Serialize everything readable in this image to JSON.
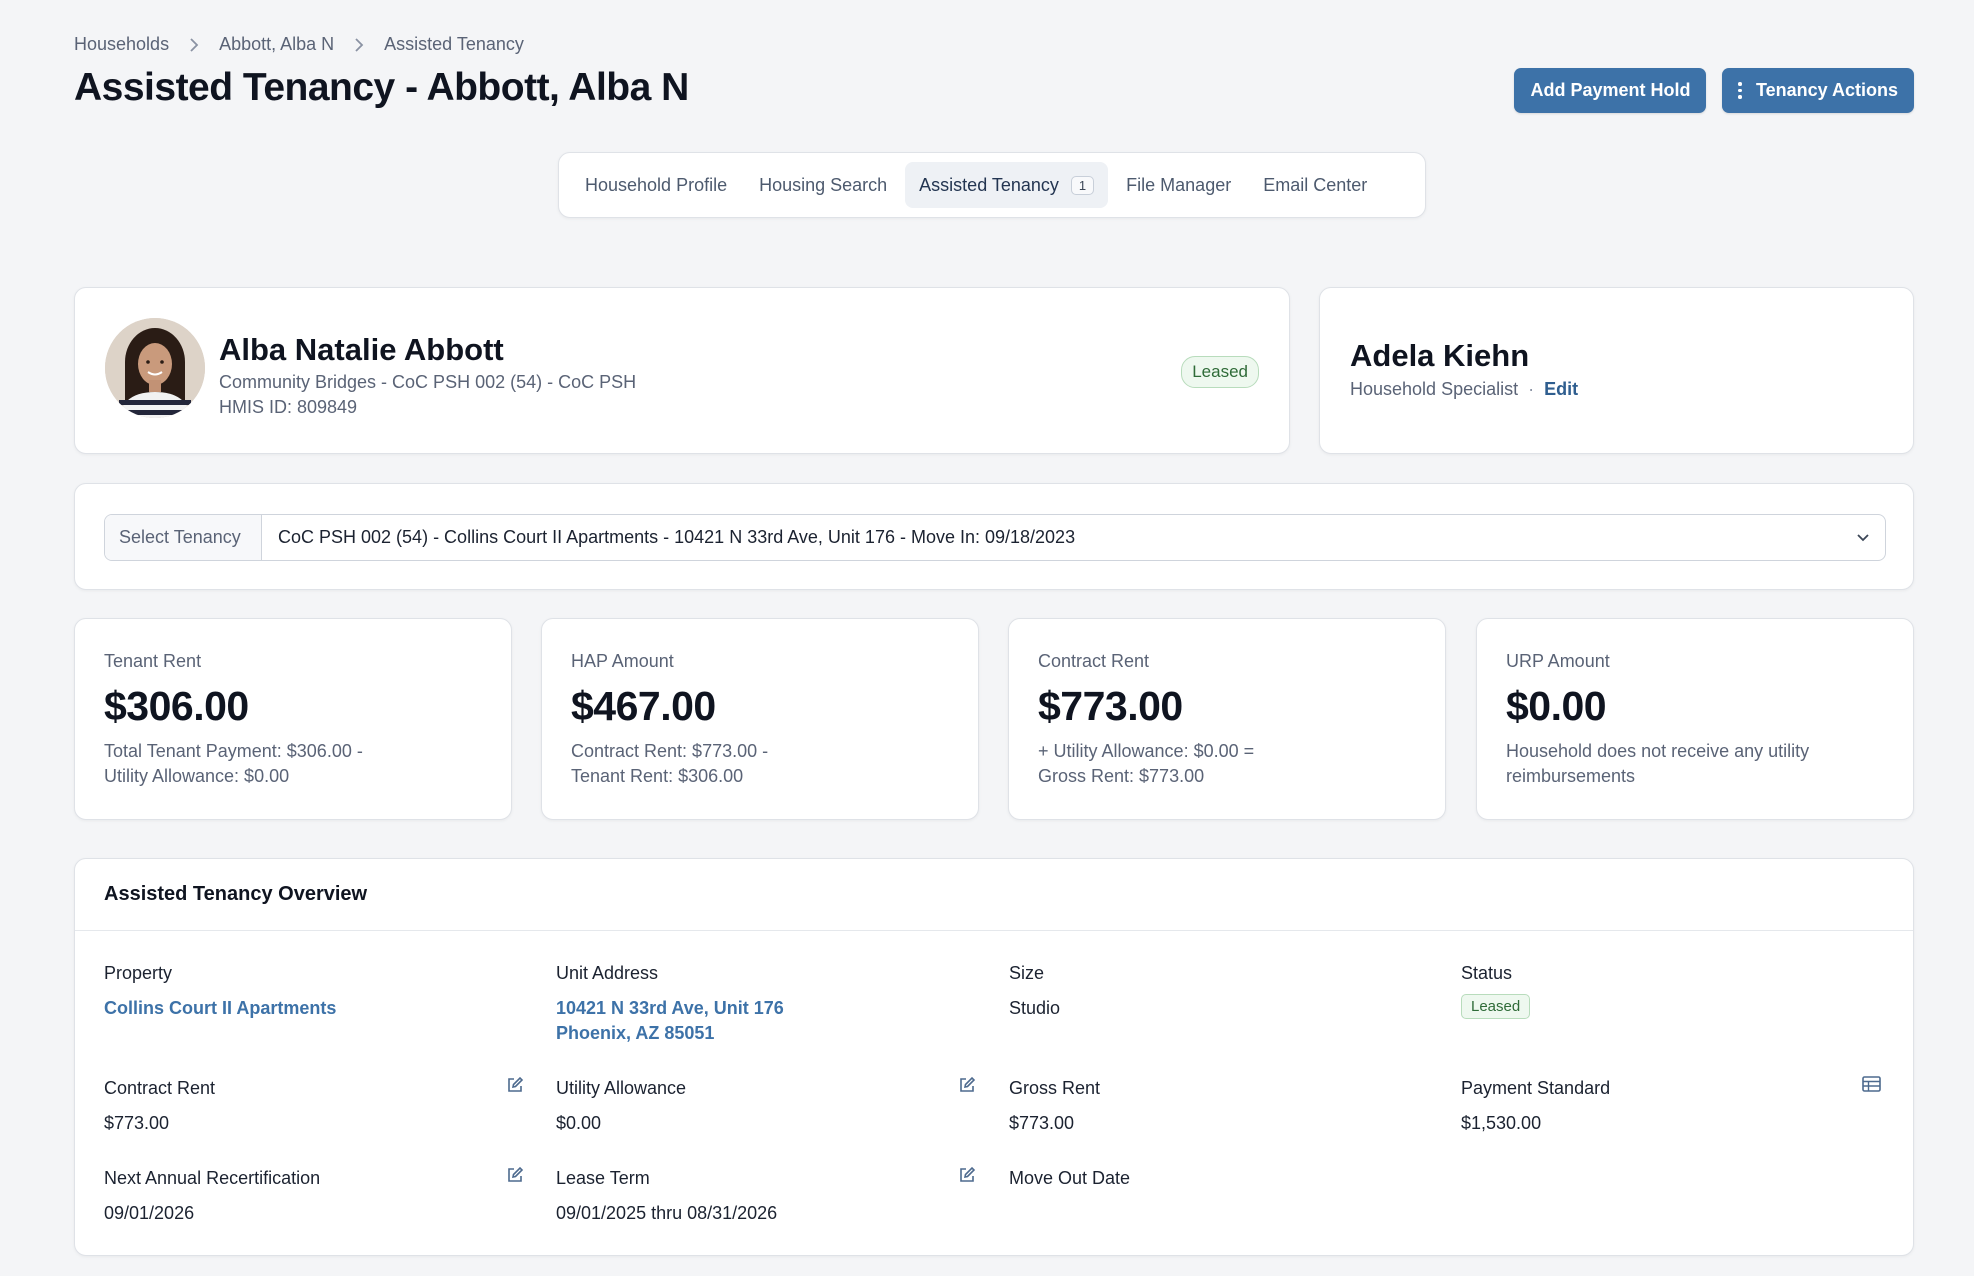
{
  "breadcrumb": [
    "Households",
    "Abbott, Alba N",
    "Assisted Tenancy"
  ],
  "page_title": "Assisted Tenancy - Abbott, Alba N",
  "actions": {
    "add_payment_hold": "Add Payment Hold",
    "tenancy_actions": "Tenancy Actions"
  },
  "tabs": [
    {
      "label": "Household Profile"
    },
    {
      "label": "Housing Search"
    },
    {
      "label": "Assisted Tenancy",
      "count": "1"
    },
    {
      "label": "File Manager"
    },
    {
      "label": "Email Center"
    }
  ],
  "profile": {
    "name": "Alba Natalie Abbott",
    "program": "Community Bridges - CoC PSH 002 (54) - CoC PSH",
    "hmis": "HMIS ID: 809849",
    "status": "Leased"
  },
  "specialist": {
    "name": "Adela Kiehn",
    "role": "Household Specialist",
    "separator": "·",
    "edit": "Edit"
  },
  "select_tenancy": {
    "label": "Select Tenancy",
    "value": "CoC PSH 002 (54) - Collins Court II Apartments - 10421 N 33rd Ave, Unit 176 - Move In: 09/18/2023"
  },
  "stats": [
    {
      "label": "Tenant Rent",
      "value": "$306.00",
      "line1": "Total Tenant Payment: $306.00 -",
      "line2": "Utility Allowance: $0.00"
    },
    {
      "label": "HAP Amount",
      "value": "$467.00",
      "line1": "Contract Rent: $773.00 -",
      "line2": "Tenant Rent: $306.00"
    },
    {
      "label": "Contract Rent",
      "value": "$773.00",
      "line1": "+ Utility Allowance: $0.00 =",
      "line2": "Gross Rent: $773.00"
    },
    {
      "label": "URP Amount",
      "value": "$0.00",
      "line1": "Household does not receive any utility",
      "line2": "reimbursements"
    }
  ],
  "overview": {
    "title": "Assisted Tenancy Overview",
    "property": {
      "label": "Property",
      "value": "Collins Court II Apartments"
    },
    "unit_address": {
      "label": "Unit Address",
      "line1": "10421 N 33rd Ave, Unit 176",
      "line2": "Phoenix, AZ 85051"
    },
    "size": {
      "label": "Size",
      "value": "Studio"
    },
    "status": {
      "label": "Status",
      "value": "Leased"
    },
    "contract_rent": {
      "label": "Contract Rent",
      "value": "$773.00"
    },
    "utility_allowance": {
      "label": "Utility Allowance",
      "value": "$0.00"
    },
    "gross_rent": {
      "label": "Gross Rent",
      "value": "$773.00"
    },
    "payment_standard": {
      "label": "Payment Standard",
      "value": "$1,530.00"
    },
    "next_recert": {
      "label": "Next Annual Recertification",
      "value": "09/01/2026"
    },
    "lease_term": {
      "label": "Lease Term",
      "value": "09/01/2025 thru 08/31/2026"
    },
    "move_out": {
      "label": "Move Out Date",
      "value": ""
    }
  },
  "colors": {
    "primary": "#3d72a8",
    "leased_green": "#2f6b38",
    "background": "#f4f5f7"
  }
}
